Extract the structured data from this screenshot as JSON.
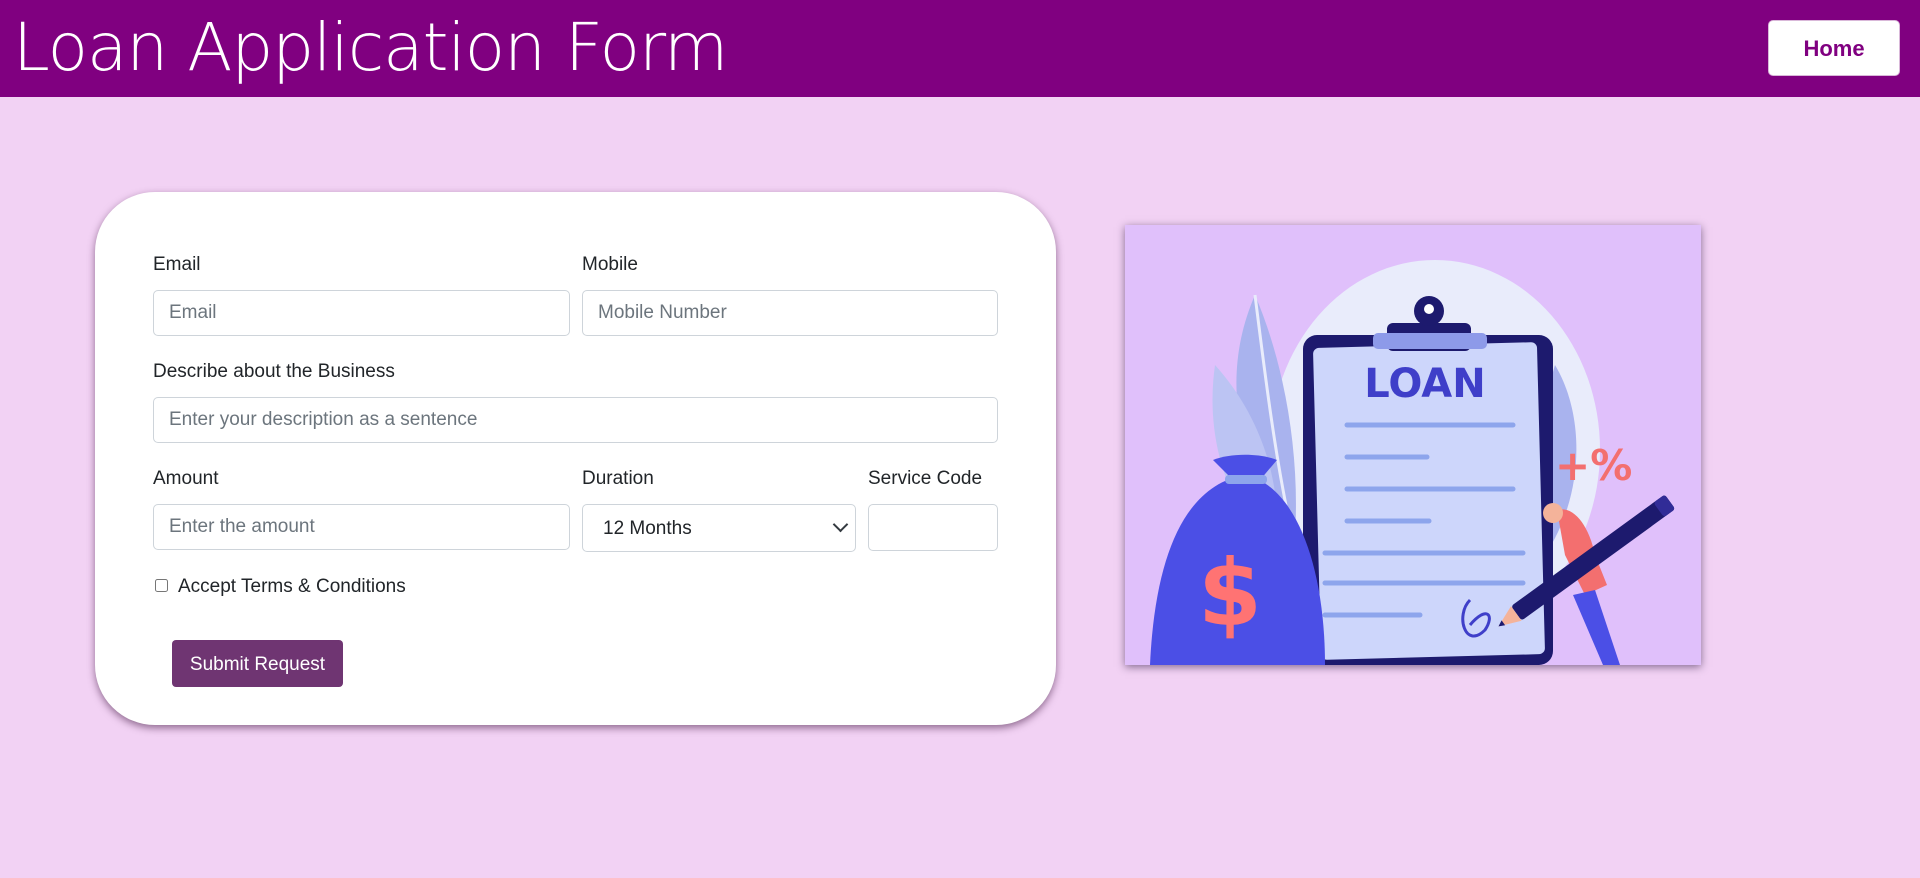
{
  "header": {
    "title": "Loan Application Form",
    "home_label": "Home",
    "color": "#800080"
  },
  "form": {
    "email": {
      "label": "Email",
      "placeholder": "Email",
      "value": ""
    },
    "mobile": {
      "label": "Mobile",
      "placeholder": "Mobile Number",
      "value": ""
    },
    "business": {
      "label": "Describe about the Business",
      "placeholder": "Enter your description as a sentence",
      "value": ""
    },
    "amount": {
      "label": "Amount",
      "placeholder": "Enter the amount",
      "value": ""
    },
    "duration": {
      "label": "Duration",
      "selected": "12 Months"
    },
    "service_code": {
      "label": "Service Code",
      "value": ""
    },
    "terms_label": "Accept Terms & Conditions",
    "terms_checked": false,
    "submit_label": "Submit Request",
    "submit_color": "#6f3572"
  },
  "illustration": {
    "icon": "loan-clipboard-illustration",
    "clipboard_text": "LOAN",
    "money_symbol": "$",
    "percent_symbol": "+%",
    "background": "#e0c0fb"
  },
  "page": {
    "background": "#f2d2f4"
  }
}
